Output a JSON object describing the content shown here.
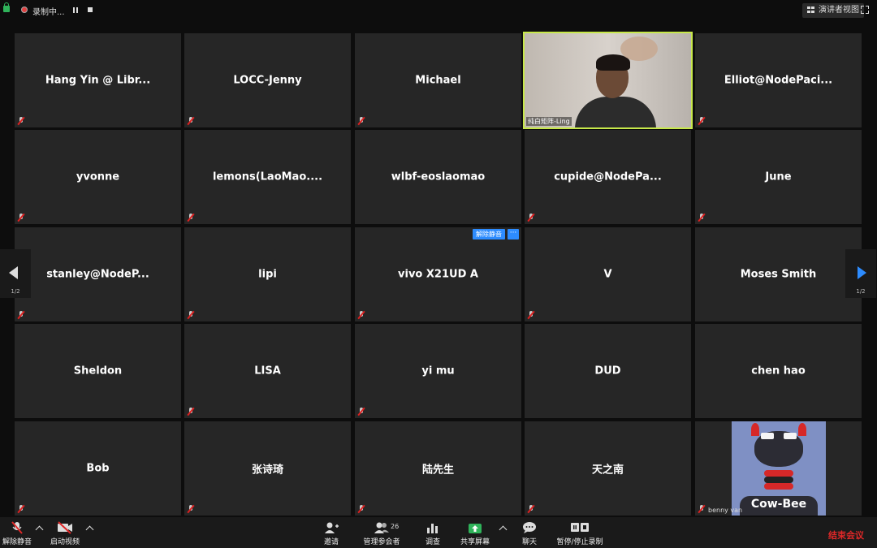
{
  "topbar": {
    "recording_text": "录制中...",
    "view_button": "演讲者视图"
  },
  "tiles": [
    {
      "name": "Hang Yin @ Libr..."
    },
    {
      "name": "LOCC-Jenny"
    },
    {
      "name": "Michael"
    },
    {
      "name": "",
      "video_label": "纯白矩阵-Ling"
    },
    {
      "name": "Elliot@NodePaci..."
    },
    {
      "name": "yvonne"
    },
    {
      "name": "lemons(LaoMao...."
    },
    {
      "name": "wlbf-eoslaomao"
    },
    {
      "name": "cupide@NodePa..."
    },
    {
      "name": "June"
    },
    {
      "name": "stanley@NodeP..."
    },
    {
      "name": "lipi"
    },
    {
      "name": "vivo X21UD A"
    },
    {
      "name": "V"
    },
    {
      "name": "Moses Smith"
    },
    {
      "name": "Sheldon"
    },
    {
      "name": "LISA"
    },
    {
      "name": "yi mu"
    },
    {
      "name": "DUD"
    },
    {
      "name": "chen hao"
    },
    {
      "name": "Bob"
    },
    {
      "name": "张诗琦"
    },
    {
      "name": "陆先生"
    },
    {
      "name": "天之南"
    },
    {
      "name": "",
      "tile_label": "benny van",
      "avatar_text": "Cow-Bee"
    }
  ],
  "overlay": {
    "unmute_label": "解除静音",
    "more_label": "···"
  },
  "pager": {
    "left_page": "1/2",
    "right_page": "1/2"
  },
  "toolbar": {
    "unmute": "解除静音",
    "start_video": "启动视频",
    "invite": "邀请",
    "manage_participants": "管理参会者",
    "participant_count": "26",
    "poll": "调查",
    "share_screen": "共享屏幕",
    "chat": "聊天",
    "pause_stop_recording": "暂停/停止录制",
    "end_meeting": "结束会议"
  },
  "colors": {
    "active_speaker_border": "#c7e84a",
    "accent_blue": "#2d8cff",
    "end_red": "#e02828",
    "share_green": "#2fb35a"
  }
}
